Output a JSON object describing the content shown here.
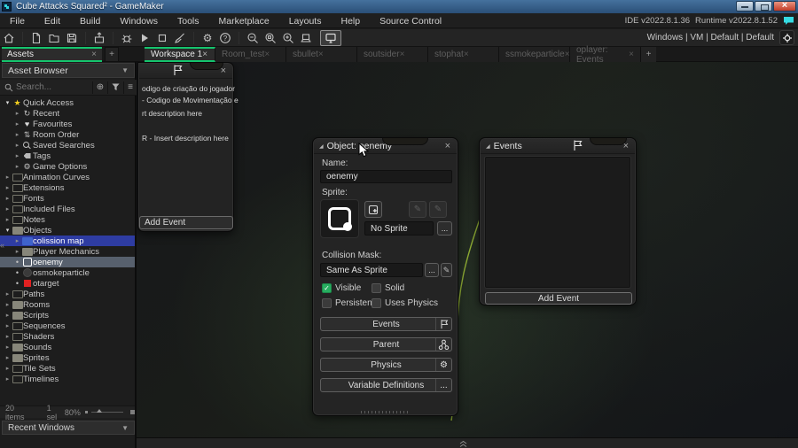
{
  "titlebar": {
    "title": "Cube Attacks Squared² - GameMaker"
  },
  "menubar": {
    "items": [
      "File",
      "Edit",
      "Build",
      "Windows",
      "Tools",
      "Marketplace",
      "Layouts",
      "Help",
      "Source Control"
    ],
    "ide_version": "IDE v2022.8.1.36",
    "runtime_version": "Runtime v2022.8.1.52"
  },
  "toolbar": {
    "target_text": "Windows | VM | Default | Default"
  },
  "tabs": {
    "assets_tab": "Assets",
    "add_tab": "+",
    "workspace_tabs": [
      {
        "label": "Workspace 1",
        "active": true
      },
      {
        "label": "Room_test",
        "active": false
      },
      {
        "label": "sbullet",
        "active": false
      },
      {
        "label": "soutsider",
        "active": false
      },
      {
        "label": "stophat",
        "active": false
      },
      {
        "label": "ssmokeparticle",
        "active": false
      },
      {
        "label": "oplayer: Events",
        "active": false
      }
    ]
  },
  "asset_panel": {
    "browser_label": "Asset Browser",
    "search_placeholder": "Search...",
    "tree": [
      {
        "label": "Quick Access",
        "icon": "star",
        "depth": 0,
        "state": "open",
        "selected": null
      },
      {
        "label": "Recent",
        "icon": "recent",
        "depth": 1,
        "state": "closed",
        "selected": null
      },
      {
        "label": "Favourites",
        "icon": "heart",
        "depth": 1,
        "state": "closed",
        "selected": null
      },
      {
        "label": "Room Order",
        "icon": "room-order",
        "depth": 1,
        "state": "closed",
        "selected": null
      },
      {
        "label": "Saved Searches",
        "icon": "search",
        "depth": 1,
        "state": "closed",
        "selected": null
      },
      {
        "label": "Tags",
        "icon": "tag",
        "depth": 1,
        "state": "closed",
        "selected": null
      },
      {
        "label": "Game Options",
        "icon": "gear",
        "depth": 1,
        "state": "closed",
        "selected": null
      },
      {
        "label": "Animation Curves",
        "icon": "folder",
        "depth": 0,
        "state": "closed",
        "selected": null
      },
      {
        "label": "Extensions",
        "icon": "folder",
        "depth": 0,
        "state": "closed",
        "selected": null
      },
      {
        "label": "Fonts",
        "icon": "folder",
        "depth": 0,
        "state": "closed",
        "selected": null
      },
      {
        "label": "Included Files",
        "icon": "folder",
        "depth": 0,
        "state": "closed",
        "selected": null
      },
      {
        "label": "Notes",
        "icon": "folder",
        "depth": 0,
        "state": "closed",
        "selected": null
      },
      {
        "label": "Objects",
        "icon": "folder-filled",
        "depth": 0,
        "state": "open",
        "selected": null
      },
      {
        "label": "colission map",
        "icon": "folder-blue",
        "depth": 1,
        "state": "closed",
        "selected": "blue"
      },
      {
        "label": "Player Mechanics",
        "icon": "folder-filled",
        "depth": 1,
        "state": "closed",
        "selected": null
      },
      {
        "label": "oenemy",
        "icon": "object-sprite",
        "depth": 1,
        "state": "item",
        "selected": "gray"
      },
      {
        "label": "osmokeparticle",
        "icon": "object-circle",
        "depth": 1,
        "state": "item",
        "selected": null
      },
      {
        "label": "otarget",
        "icon": "object-red",
        "depth": 1,
        "state": "item",
        "selected": null
      },
      {
        "label": "Paths",
        "icon": "folder",
        "depth": 0,
        "state": "closed",
        "selected": null
      },
      {
        "label": "Rooms",
        "icon": "folder-filled",
        "depth": 0,
        "state": "closed",
        "selected": null
      },
      {
        "label": "Scripts",
        "icon": "folder-filled",
        "depth": 0,
        "state": "closed",
        "selected": null
      },
      {
        "label": "Sequences",
        "icon": "folder",
        "depth": 0,
        "state": "closed",
        "selected": null
      },
      {
        "label": "Shaders",
        "icon": "folder",
        "depth": 0,
        "state": "closed",
        "selected": null
      },
      {
        "label": "Sounds",
        "icon": "folder-filled",
        "depth": 0,
        "state": "closed",
        "selected": null
      },
      {
        "label": "Sprites",
        "icon": "folder-filled",
        "depth": 0,
        "state": "closed",
        "selected": null
      },
      {
        "label": "Tile Sets",
        "icon": "folder",
        "depth": 0,
        "state": "closed",
        "selected": null
      },
      {
        "label": "Timelines",
        "icon": "folder",
        "depth": 0,
        "state": "closed",
        "selected": null
      }
    ],
    "status": {
      "items_count": "20 items",
      "selected_count": "1 sel",
      "zoom": "80%"
    },
    "recent_windows_label": "Recent Windows"
  },
  "player_events_window": {
    "lines": [
      "odigo de criação do jogador",
      "- Codigo de Movimentação e",
      "rt description here",
      "R - Insert description here"
    ],
    "add_event_label": "Add Event"
  },
  "object_window": {
    "title": "Object: oenemy",
    "name_label": "Name:",
    "name_value": "oenemy",
    "sprite_label": "Sprite:",
    "sprite_select_value": "No Sprite",
    "more_label": "...",
    "collision_label": "Collision Mask:",
    "collision_select_value": "Same As Sprite",
    "checkboxes": [
      {
        "label": "Visible",
        "checked": true
      },
      {
        "label": "Solid",
        "checked": false
      },
      {
        "label": "Persistent",
        "checked": false
      },
      {
        "label": "Uses Physics",
        "checked": false
      }
    ],
    "buttons": [
      {
        "label": "Events",
        "icon": "flag"
      },
      {
        "label": "Parent",
        "icon": "parent"
      },
      {
        "label": "Physics",
        "icon": "gear"
      },
      {
        "label": "Variable Definitions",
        "icon": "ellipsis"
      }
    ]
  },
  "events_window": {
    "title": "Events",
    "add_event_label": "Add Event"
  },
  "colors": {
    "accent_green": "#15c46d",
    "selection_blue": "#2e3ca2",
    "selection_gray": "#57606d",
    "check_green": "#27ae60",
    "connection_curve": "#93b235",
    "target_red": "#e02121"
  }
}
